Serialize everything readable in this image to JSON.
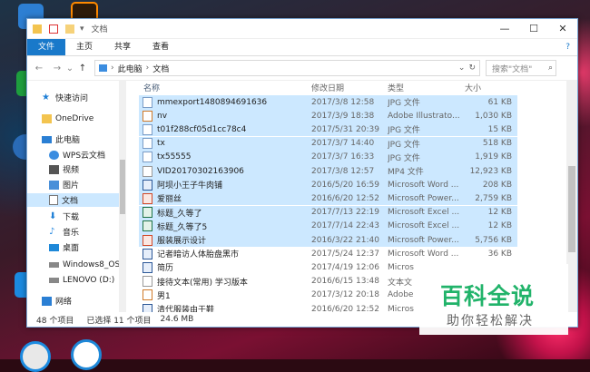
{
  "window": {
    "title": "文档"
  },
  "caption_buttons": {
    "min": "—",
    "max": "☐",
    "close": "✕"
  },
  "ribbon": {
    "tabs": [
      "文件",
      "主页",
      "共享",
      "查看"
    ]
  },
  "address": {
    "back": "←",
    "forward": "→",
    "recent": "⌄",
    "up": "↑",
    "crumbs": [
      "此电脑",
      "文档"
    ],
    "sep": "›",
    "search_placeholder": "搜索\"文档\"",
    "search_icon": "⌕",
    "refresh": "↻"
  },
  "nav": {
    "items": [
      {
        "label": "快速访问",
        "icon": "star-icon",
        "color": "#1e7fd6"
      },
      {
        "label": "OneDrive",
        "icon": "folder-icon",
        "color": "#f3c44f"
      },
      {
        "label": "此电脑",
        "icon": "computer-icon",
        "color": "#2a7fd4"
      },
      {
        "label": "WPS云文档",
        "icon": "cloud-icon",
        "color": "#3b8de0"
      },
      {
        "label": "视频",
        "icon": "video-icon",
        "color": "#555"
      },
      {
        "label": "图片",
        "icon": "picture-icon",
        "color": "#4a90d9"
      },
      {
        "label": "文档",
        "icon": "document-icon",
        "color": "#777"
      },
      {
        "label": "下载",
        "icon": "download-icon",
        "color": "#1e7fd6"
      },
      {
        "label": "音乐",
        "icon": "music-icon",
        "color": "#2a8ae0"
      },
      {
        "label": "桌面",
        "icon": "desktop-icon",
        "color": "#1e88d8"
      },
      {
        "label": "Windows8_OS",
        "icon": "drive-icon",
        "color": "#666"
      },
      {
        "label": "LENOVO (D:)",
        "icon": "drive-icon",
        "color": "#666"
      },
      {
        "label": "网络",
        "icon": "network-icon",
        "color": "#2a7fd4"
      }
    ]
  },
  "table": {
    "sort_indicator": "^",
    "columns": [
      "名称",
      "修改日期",
      "类型",
      "大小"
    ],
    "rows": [
      {
        "name": "mmexport1480894691636",
        "date": "2017/3/8 12:58",
        "type": "JPG 文件",
        "size": "61 KB",
        "icon": "image-file-icon",
        "selected": true
      },
      {
        "name": "nv",
        "date": "2017/3/9 18:38",
        "type": "Adobe Illustrato...",
        "size": "1,030 KB",
        "icon": "ai-file-icon",
        "selected": true
      },
      {
        "name": "t01f288cf05d1cc78c4",
        "date": "2017/5/31 20:39",
        "type": "JPG 文件",
        "size": "15 KB",
        "icon": "image-file-icon",
        "selected": true
      },
      {
        "name": "tx",
        "date": "2017/3/7 14:40",
        "type": "JPG 文件",
        "size": "518 KB",
        "icon": "image-file-icon",
        "selected": true
      },
      {
        "name": "tx55555",
        "date": "2017/3/7 16:33",
        "type": "JPG 文件",
        "size": "1,919 KB",
        "icon": "image-file-icon",
        "selected": true
      },
      {
        "name": "VID20170302163906",
        "date": "2017/3/8 12:57",
        "type": "MP4 文件",
        "size": "12,923 KB",
        "icon": "video-file-icon",
        "selected": true
      },
      {
        "name": "阿坝小王子牛肉铺",
        "date": "2016/5/20 16:59",
        "type": "Microsoft Word ...",
        "size": "208 KB",
        "icon": "word-file-icon",
        "selected": true
      },
      {
        "name": "爱丽丝",
        "date": "2016/6/20 12:52",
        "type": "Microsoft Power...",
        "size": "2,759 KB",
        "icon": "ppt-file-icon",
        "selected": true
      },
      {
        "name": "标题_久等了",
        "date": "2017/7/13 22:19",
        "type": "Microsoft Excel ...",
        "size": "12 KB",
        "icon": "excel-file-icon",
        "selected": true
      },
      {
        "name": "标题_久等了5",
        "date": "2017/7/14 22:43",
        "type": "Microsoft Excel ...",
        "size": "12 KB",
        "icon": "excel-file-icon",
        "selected": true
      },
      {
        "name": "服装展示设计",
        "date": "2016/3/22 21:40",
        "type": "Microsoft Power...",
        "size": "5,756 KB",
        "icon": "ppt-file-icon",
        "selected": true
      },
      {
        "name": "记者暗访人体胎盘黑市",
        "date": "2017/5/24 12:37",
        "type": "Microsoft Word ...",
        "size": "36 KB",
        "icon": "word-file-icon",
        "selected": false
      },
      {
        "name": "简历",
        "date": "2017/4/19 12:06",
        "type": "Micros",
        "size": "",
        "icon": "word-file-icon",
        "selected": false
      },
      {
        "name": "接待文本(常用) 学习版本",
        "date": "2016/6/15 13:48",
        "type": "文本文",
        "size": "",
        "icon": "text-file-icon",
        "selected": false
      },
      {
        "name": "男1",
        "date": "2017/3/12 20:18",
        "type": "Adobe",
        "size": "",
        "icon": "ai-file-icon",
        "selected": false
      },
      {
        "name": "清代服装由于鞋",
        "date": "2016/6/20 12:52",
        "type": "Micros",
        "size": "",
        "icon": "word-file-icon",
        "selected": false
      }
    ]
  },
  "status": {
    "count": "48 个项目",
    "selected": "已选择 11 个项目",
    "size": "24.6 MB"
  },
  "watermark": {
    "main": "百科全说",
    "sub": "助你轻松解决"
  }
}
